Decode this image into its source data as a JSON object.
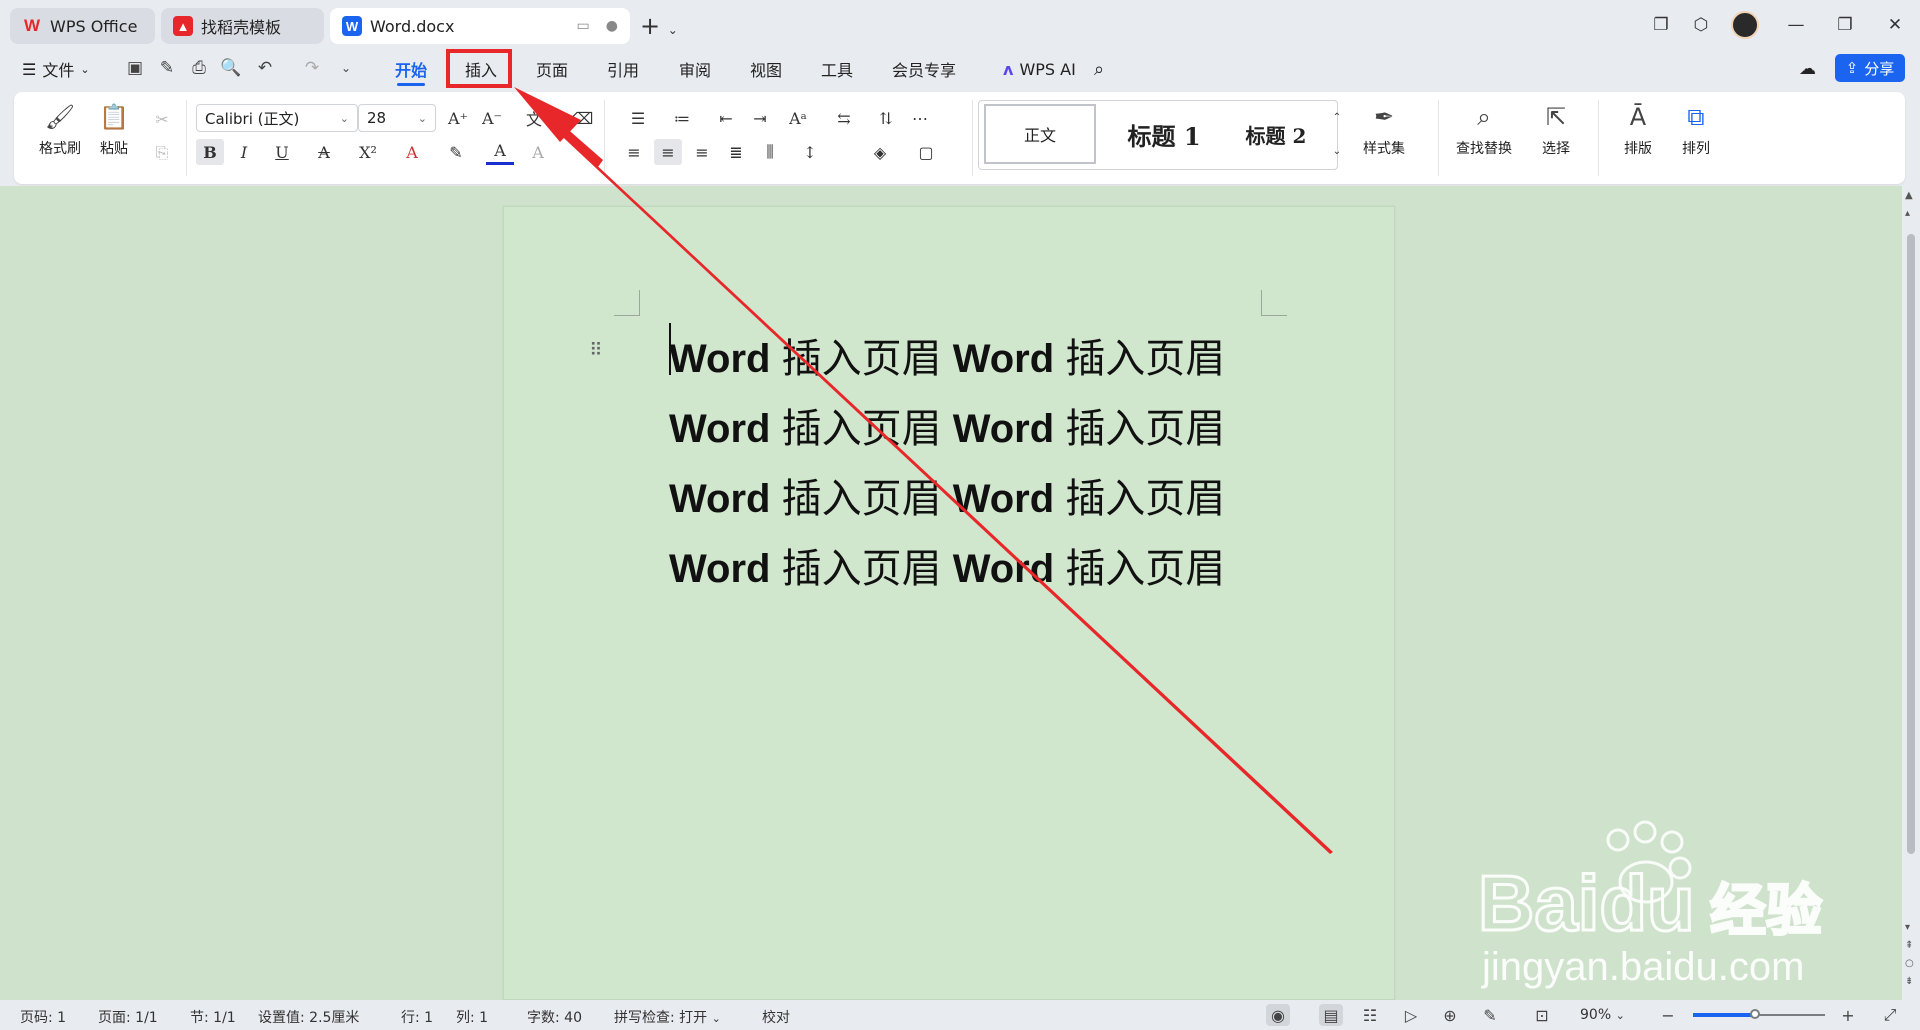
{
  "tabs": [
    {
      "label": "WPS Office",
      "icon": "wps-logo-icon",
      "color": "#e8272a"
    },
    {
      "label": "找稻壳模板",
      "icon": "daoke-template-icon",
      "color": "#e8272a"
    },
    {
      "label": "Word.docx",
      "icon": "word-doc-icon",
      "color": "#1a64f0"
    }
  ],
  "menubar": {
    "file_label": "文件",
    "tabs": [
      "开始",
      "插入",
      "页面",
      "引用",
      "审阅",
      "视图",
      "工具",
      "会员专享"
    ],
    "active_tab": "开始",
    "highlighted_tab": "插入",
    "wps_ai_label": "WPS AI",
    "share_label": "分享"
  },
  "ribbon": {
    "format_painter": "格式刷",
    "paste": "粘贴",
    "font_name": "Calibri (正文)",
    "font_size": "28",
    "styles": {
      "normal": "正文",
      "heading1": "标题 1",
      "heading2": "标题 2"
    },
    "style_set": "样式集",
    "find_replace": "查找替换",
    "select": "选择",
    "layout": "排版",
    "arrange": "排列"
  },
  "document": {
    "lines": [
      [
        "Word",
        "插入页眉",
        "Word",
        "插入页眉"
      ],
      [
        "Word",
        "插入页眉",
        "Word",
        "插入页眉"
      ],
      [
        "Word",
        "插入页眉",
        "Word",
        "插入页眉"
      ],
      [
        "Word",
        "插入页眉",
        "Word",
        "插入页眉"
      ]
    ]
  },
  "statusbar": {
    "page_num": "页码: 1",
    "pages": "页面: 1/1",
    "section": "节: 1/1",
    "setting": "设置值: 2.5厘米",
    "row": "行: 1",
    "col": "列: 1",
    "word_count": "字数: 40",
    "spell_check": "拼写检查: 打开",
    "proofread": "校对",
    "zoom": "90%",
    "zoom_fraction": 0.47
  },
  "watermark": {
    "brand": "Baidu",
    "suffix": "经验",
    "url": "jingyan.baidu.com"
  },
  "colors": {
    "accent": "#1a64f0",
    "annotation_red": "#e8272a",
    "page_bg": "#d0e7cd"
  }
}
